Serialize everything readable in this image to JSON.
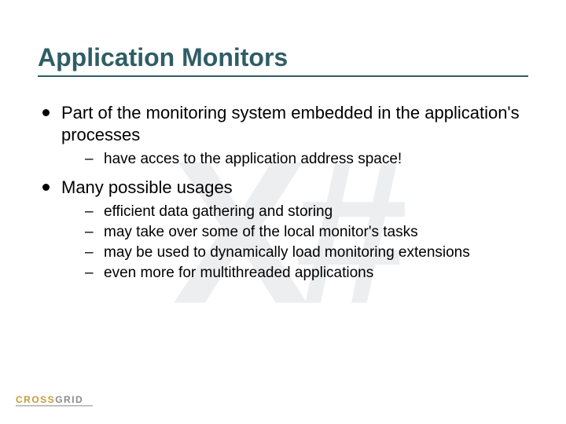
{
  "watermark": "X#",
  "title": "Application Monitors",
  "bullets": [
    {
      "text": "Part of the monitoring system embedded in the application's processes",
      "subs": [
        "have acces to the application address space!"
      ]
    },
    {
      "text": "Many possible usages",
      "subs": [
        "efficient data gathering and storing",
        "may take over some of the local monitor's tasks",
        "may be used to dynamically load monitoring extensions",
        "even more for multithreaded applications"
      ]
    }
  ],
  "logo_text": "CROSSGRID"
}
